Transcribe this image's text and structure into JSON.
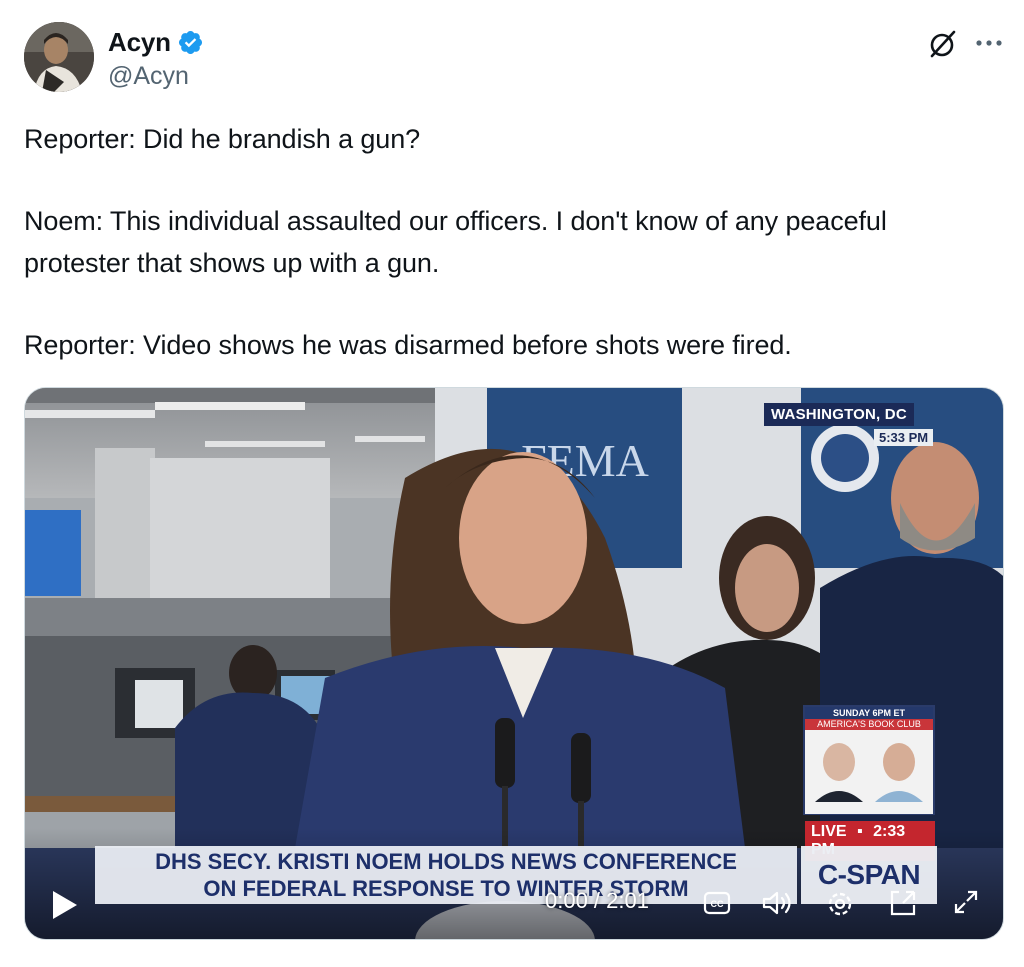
{
  "author": {
    "display_name": "Acyn",
    "handle": "@Acyn",
    "verified": true,
    "verified_color": "#1d9bf0"
  },
  "header_icons": [
    "grok-icon",
    "more-icon"
  ],
  "tweet": {
    "paragraphs": [
      "Reporter: Did he brandish a gun?",
      "Noem: This individual assaulted our officers. I don't know of any peaceful protester that shows up with a gun.",
      "Reporter: Video shows he was disarmed before shots were fired."
    ]
  },
  "video": {
    "overlay": {
      "location": "WASHINGTON, DC",
      "location_time": "5:33 PM",
      "sign_text": "FEMA",
      "promo_top": "SUNDAY 6PM ET",
      "promo_title": "AMERICA'S BOOK CLUB",
      "live_label": "LIVE",
      "live_time": "2:33 PM",
      "chyron_line1": "DHS SECY. KRISTI NOEM HOLDS NEWS CONFERENCE",
      "chyron_line2": "ON FEDERAL RESPONSE TO WINTER STORM",
      "network": "C-SPAN"
    },
    "player": {
      "time_display": "0:00 / 2:01",
      "progress": 0,
      "icons": [
        "play-icon",
        "captions-icon",
        "volume-icon",
        "settings-icon",
        "pip-icon",
        "fullscreen-icon"
      ]
    }
  }
}
